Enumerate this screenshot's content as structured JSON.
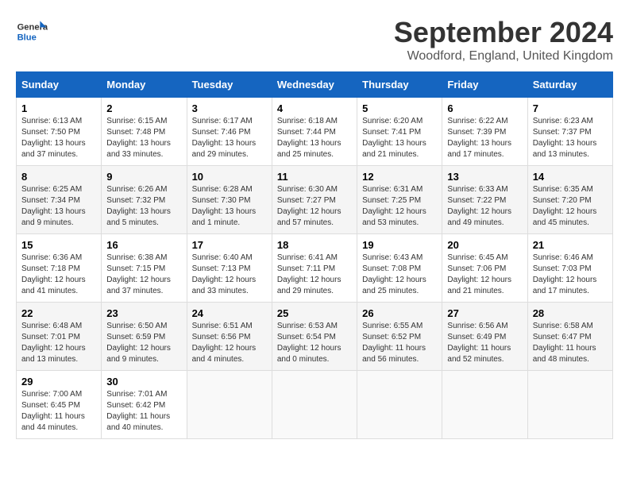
{
  "logo": {
    "line1": "General",
    "line2": "Blue"
  },
  "title": "September 2024",
  "location": "Woodford, England, United Kingdom",
  "weekdays": [
    "Sunday",
    "Monday",
    "Tuesday",
    "Wednesday",
    "Thursday",
    "Friday",
    "Saturday"
  ],
  "weeks": [
    [
      {
        "day": "1",
        "sunrise": "6:13 AM",
        "sunset": "7:50 PM",
        "daylight": "13 hours and 37 minutes."
      },
      {
        "day": "2",
        "sunrise": "6:15 AM",
        "sunset": "7:48 PM",
        "daylight": "13 hours and 33 minutes."
      },
      {
        "day": "3",
        "sunrise": "6:17 AM",
        "sunset": "7:46 PM",
        "daylight": "13 hours and 29 minutes."
      },
      {
        "day": "4",
        "sunrise": "6:18 AM",
        "sunset": "7:44 PM",
        "daylight": "13 hours and 25 minutes."
      },
      {
        "day": "5",
        "sunrise": "6:20 AM",
        "sunset": "7:41 PM",
        "daylight": "13 hours and 21 minutes."
      },
      {
        "day": "6",
        "sunrise": "6:22 AM",
        "sunset": "7:39 PM",
        "daylight": "13 hours and 17 minutes."
      },
      {
        "day": "7",
        "sunrise": "6:23 AM",
        "sunset": "7:37 PM",
        "daylight": "13 hours and 13 minutes."
      }
    ],
    [
      {
        "day": "8",
        "sunrise": "6:25 AM",
        "sunset": "7:34 PM",
        "daylight": "13 hours and 9 minutes."
      },
      {
        "day": "9",
        "sunrise": "6:26 AM",
        "sunset": "7:32 PM",
        "daylight": "13 hours and 5 minutes."
      },
      {
        "day": "10",
        "sunrise": "6:28 AM",
        "sunset": "7:30 PM",
        "daylight": "13 hours and 1 minute."
      },
      {
        "day": "11",
        "sunrise": "6:30 AM",
        "sunset": "7:27 PM",
        "daylight": "12 hours and 57 minutes."
      },
      {
        "day": "12",
        "sunrise": "6:31 AM",
        "sunset": "7:25 PM",
        "daylight": "12 hours and 53 minutes."
      },
      {
        "day": "13",
        "sunrise": "6:33 AM",
        "sunset": "7:22 PM",
        "daylight": "12 hours and 49 minutes."
      },
      {
        "day": "14",
        "sunrise": "6:35 AM",
        "sunset": "7:20 PM",
        "daylight": "12 hours and 45 minutes."
      }
    ],
    [
      {
        "day": "15",
        "sunrise": "6:36 AM",
        "sunset": "7:18 PM",
        "daylight": "12 hours and 41 minutes."
      },
      {
        "day": "16",
        "sunrise": "6:38 AM",
        "sunset": "7:15 PM",
        "daylight": "12 hours and 37 minutes."
      },
      {
        "day": "17",
        "sunrise": "6:40 AM",
        "sunset": "7:13 PM",
        "daylight": "12 hours and 33 minutes."
      },
      {
        "day": "18",
        "sunrise": "6:41 AM",
        "sunset": "7:11 PM",
        "daylight": "12 hours and 29 minutes."
      },
      {
        "day": "19",
        "sunrise": "6:43 AM",
        "sunset": "7:08 PM",
        "daylight": "12 hours and 25 minutes."
      },
      {
        "day": "20",
        "sunrise": "6:45 AM",
        "sunset": "7:06 PM",
        "daylight": "12 hours and 21 minutes."
      },
      {
        "day": "21",
        "sunrise": "6:46 AM",
        "sunset": "7:03 PM",
        "daylight": "12 hours and 17 minutes."
      }
    ],
    [
      {
        "day": "22",
        "sunrise": "6:48 AM",
        "sunset": "7:01 PM",
        "daylight": "12 hours and 13 minutes."
      },
      {
        "day": "23",
        "sunrise": "6:50 AM",
        "sunset": "6:59 PM",
        "daylight": "12 hours and 9 minutes."
      },
      {
        "day": "24",
        "sunrise": "6:51 AM",
        "sunset": "6:56 PM",
        "daylight": "12 hours and 4 minutes."
      },
      {
        "day": "25",
        "sunrise": "6:53 AM",
        "sunset": "6:54 PM",
        "daylight": "12 hours and 0 minutes."
      },
      {
        "day": "26",
        "sunrise": "6:55 AM",
        "sunset": "6:52 PM",
        "daylight": "11 hours and 56 minutes."
      },
      {
        "day": "27",
        "sunrise": "6:56 AM",
        "sunset": "6:49 PM",
        "daylight": "11 hours and 52 minutes."
      },
      {
        "day": "28",
        "sunrise": "6:58 AM",
        "sunset": "6:47 PM",
        "daylight": "11 hours and 48 minutes."
      }
    ],
    [
      {
        "day": "29",
        "sunrise": "7:00 AM",
        "sunset": "6:45 PM",
        "daylight": "11 hours and 44 minutes."
      },
      {
        "day": "30",
        "sunrise": "7:01 AM",
        "sunset": "6:42 PM",
        "daylight": "11 hours and 40 minutes."
      },
      null,
      null,
      null,
      null,
      null
    ]
  ]
}
